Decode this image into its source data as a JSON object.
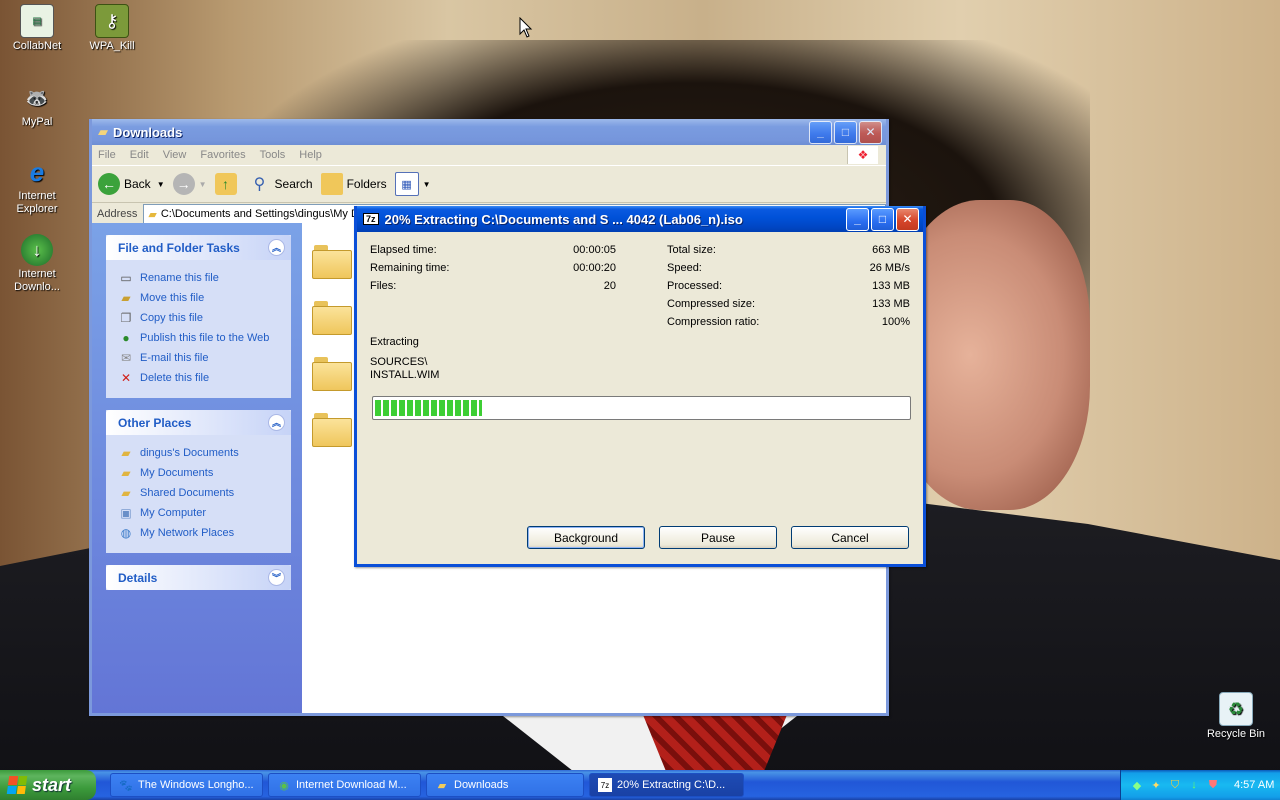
{
  "desktop": {
    "icons": [
      {
        "label": "CollabNet",
        "icon": "collabnet-icon"
      },
      {
        "label": "WPA_Kill",
        "icon": "key-icon"
      },
      {
        "label": "MyPal",
        "icon": "mypal-icon"
      },
      {
        "label": "Internet Explorer",
        "icon": "internet-explorer-icon"
      },
      {
        "label": "Internet Downlo...",
        "icon": "internet-download-manager-icon"
      },
      {
        "label": "Recycle Bin",
        "icon": "recycle-bin-icon"
      }
    ]
  },
  "explorer": {
    "title": "Downloads",
    "menu": [
      "File",
      "Edit",
      "View",
      "Favorites",
      "Tools",
      "Help"
    ],
    "toolbar": {
      "back": "Back",
      "search": "Search",
      "folders": "Folders"
    },
    "address_label": "Address",
    "address_value": "C:\\Documents and Settings\\dingus\\My D",
    "file_tasks": {
      "title": "File and Folder Tasks",
      "items": [
        "Rename this file",
        "Move this file",
        "Copy this file",
        "Publish this file to the Web",
        "E-mail this file",
        "Delete this file"
      ]
    },
    "other_places": {
      "title": "Other Places",
      "items": [
        "dingus's Documents",
        "My Documents",
        "Shared Documents",
        "My Computer",
        "My Network Places"
      ]
    },
    "details": {
      "title": "Details"
    }
  },
  "extract": {
    "title": "20% Extracting C:\\Documents and S ... 4042 (Lab06_n).iso",
    "left": [
      {
        "label": "Elapsed time:",
        "value": "00:00:05"
      },
      {
        "label": "Remaining time:",
        "value": "00:00:20"
      },
      {
        "label": "Files:",
        "value": "20"
      }
    ],
    "right": [
      {
        "label": "Total size:",
        "value": "663 MB"
      },
      {
        "label": "Speed:",
        "value": "26 MB/s"
      },
      {
        "label": "Processed:",
        "value": "133 MB"
      },
      {
        "label": "Compressed size:",
        "value": "133 MB"
      },
      {
        "label": "Compression ratio:",
        "value": "100%"
      }
    ],
    "status": "Extracting",
    "path_line1": "SOURCES\\",
    "path_line2": "INSTALL.WIM",
    "progress": 0.2,
    "buttons": {
      "background": "Background",
      "pause": "Pause",
      "cancel": "Cancel"
    }
  },
  "taskbar": {
    "start": "start",
    "tasks": [
      {
        "label": "The Windows Longho...",
        "icon": "browser-icon"
      },
      {
        "label": "Internet Download M...",
        "icon": "download-manager-icon"
      },
      {
        "label": "Downloads",
        "icon": "folder-icon"
      },
      {
        "label": "20% Extracting C:\\D...",
        "icon": "7zip-icon"
      }
    ],
    "clock": "4:57 AM"
  }
}
